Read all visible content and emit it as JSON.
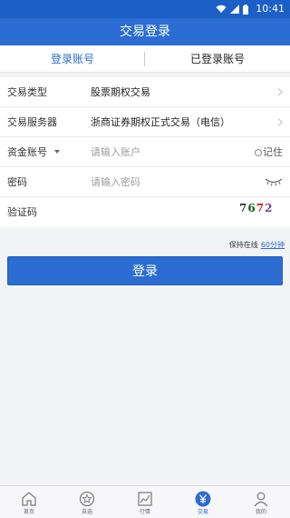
{
  "status_bar": {
    "time": "10:41"
  },
  "title": "交易登录",
  "tabs": {
    "login_account": "登录账号",
    "logged_account": "已登录账号"
  },
  "form": {
    "trade_type": {
      "label": "交易类型",
      "value": "股票期权交易"
    },
    "server": {
      "label": "交易服务器",
      "value": "浙商证券期权正式交易（电信）"
    },
    "account": {
      "label": "资金账号",
      "placeholder": "请输入账户",
      "remember": "记住"
    },
    "password": {
      "label": "密码",
      "placeholder": "请输入密码"
    },
    "captcha": {
      "label": "验证码",
      "code_chars": [
        "7",
        "6",
        "7",
        "2"
      ]
    }
  },
  "online": {
    "label": "保持在线",
    "duration": "60分钟"
  },
  "login_button": "登录",
  "nav": [
    {
      "label": "首页",
      "icon": "home-icon"
    },
    {
      "label": "自选",
      "icon": "star-icon"
    },
    {
      "label": "行情",
      "icon": "chart-icon"
    },
    {
      "label": "交易",
      "icon": "yen-icon",
      "active": true
    },
    {
      "label": "我的",
      "icon": "person-icon"
    }
  ],
  "colors": {
    "primary": "#2b6dd3",
    "status_bar": "#1c5fc6",
    "background": "#f2f3f5"
  }
}
